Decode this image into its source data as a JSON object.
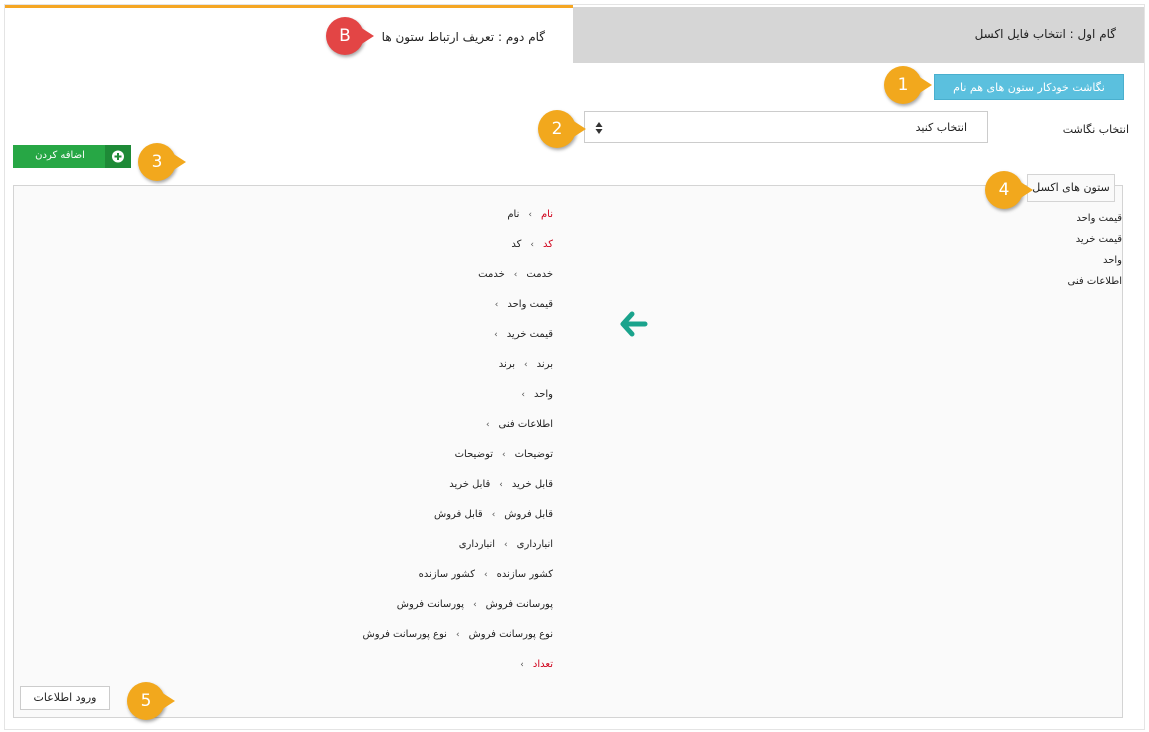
{
  "tabs": {
    "step1": "گام اول : انتخاب فایل اکسل",
    "step2": "گام دوم : تعریف ارتباط ستون ها"
  },
  "callouts": [
    "B",
    "1",
    "2",
    "3",
    "4",
    "5"
  ],
  "auto_map_button": "نگاشت خودکار ستون های هم نام",
  "mapping_select": {
    "label": "انتخاب نگاشت",
    "value": "انتخاب کنید"
  },
  "add_button": "اضافه کردن",
  "excel_columns": {
    "title": "ستون های اکسل",
    "items": [
      "قیمت واحد",
      "قیمت خرید",
      "واحد",
      "اطلاعات فنی"
    ]
  },
  "mappings": [
    {
      "field": "نام",
      "excel": "نام",
      "required": true
    },
    {
      "field": "کد",
      "excel": "کد",
      "required": true
    },
    {
      "field": "خدمت",
      "excel": "خدمت",
      "required": false
    },
    {
      "field": "قیمت واحد",
      "excel": "",
      "required": false
    },
    {
      "field": "قیمت خرید",
      "excel": "",
      "required": false
    },
    {
      "field": "برند",
      "excel": "برند",
      "required": false
    },
    {
      "field": "واحد",
      "excel": "",
      "required": false
    },
    {
      "field": "اطلاعات فنی",
      "excel": "",
      "required": false
    },
    {
      "field": "توضیحات",
      "excel": "توضیحات",
      "required": false
    },
    {
      "field": "قابل خرید",
      "excel": "قابل خرید",
      "required": false
    },
    {
      "field": "قابل فروش",
      "excel": "قابل فروش",
      "required": false
    },
    {
      "field": "انبارداری",
      "excel": "انبارداری",
      "required": false
    },
    {
      "field": "کشور سازنده",
      "excel": "کشور سازنده",
      "required": false
    },
    {
      "field": "پورسانت فروش",
      "excel": "پورسانت فروش",
      "required": false
    },
    {
      "field": "نوع پورسانت فروش",
      "excel": "نوع پورسانت فروش",
      "required": false
    },
    {
      "field": "تعداد",
      "excel": "",
      "required": true
    }
  ],
  "submit_button": "ورود اطلاعات",
  "colors": {
    "accent": "#f5a623",
    "auto_button": "#5bc0de",
    "add_button": "#27a745",
    "required_text": "#d0021b",
    "arrow": "#1aa38c",
    "callout": "#f2a81d",
    "callout_b": "#e34545"
  }
}
